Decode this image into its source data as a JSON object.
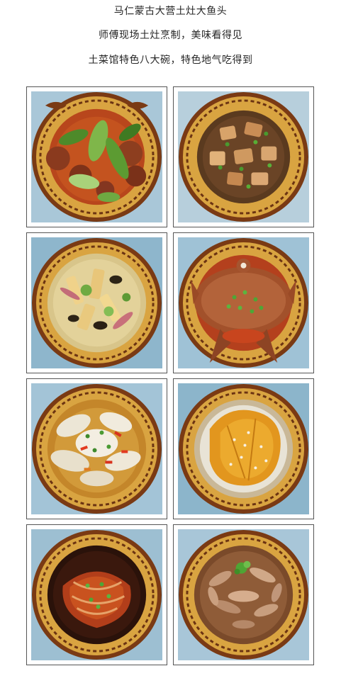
{
  "intro": {
    "line1": "马仁蒙古大营土灶大鱼头",
    "line2": "师傅现场土灶烹制，美味看得见",
    "line3": "土菜馆特色八大碗，特色地气吃得到"
  },
  "dishes": [
    {
      "subject": "braised-meatballs-with-bok-choy"
    },
    {
      "subject": "braised-tofu-with-pickled-greens"
    },
    {
      "subject": "tofu-skin-mushroom-soup"
    },
    {
      "subject": "braised-whole-fish"
    },
    {
      "subject": "fish-fillet-with-chili"
    },
    {
      "subject": "steamed-pumpkin-with-garlic"
    },
    {
      "subject": "braised-pork-belly"
    },
    {
      "subject": "stir-fried-mushrooms"
    }
  ],
  "colors": {
    "plate_gold": "#d7a442",
    "plate_rim_dark": "#5a2e12",
    "table_blue": "#9fc2d6"
  }
}
